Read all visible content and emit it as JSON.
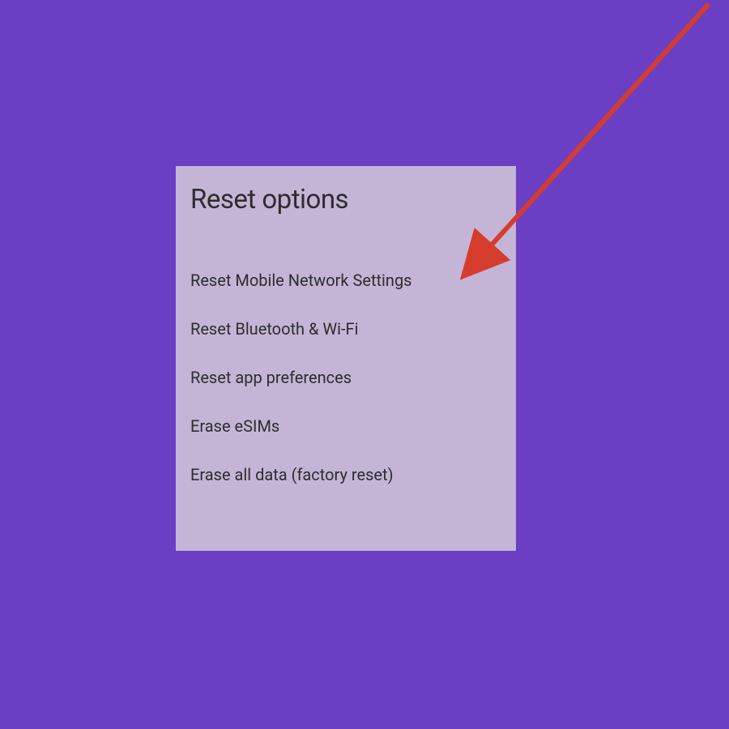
{
  "title": "Reset options",
  "options": [
    {
      "label": "Reset Mobile Network Settings"
    },
    {
      "label": "Reset Bluetooth & Wi-Fi"
    },
    {
      "label": "Reset app preferences"
    },
    {
      "label": "Erase eSIMs"
    },
    {
      "label": "Erase all data (factory reset)"
    }
  ],
  "annotation": {
    "arrow_color": "#d63c2e"
  }
}
